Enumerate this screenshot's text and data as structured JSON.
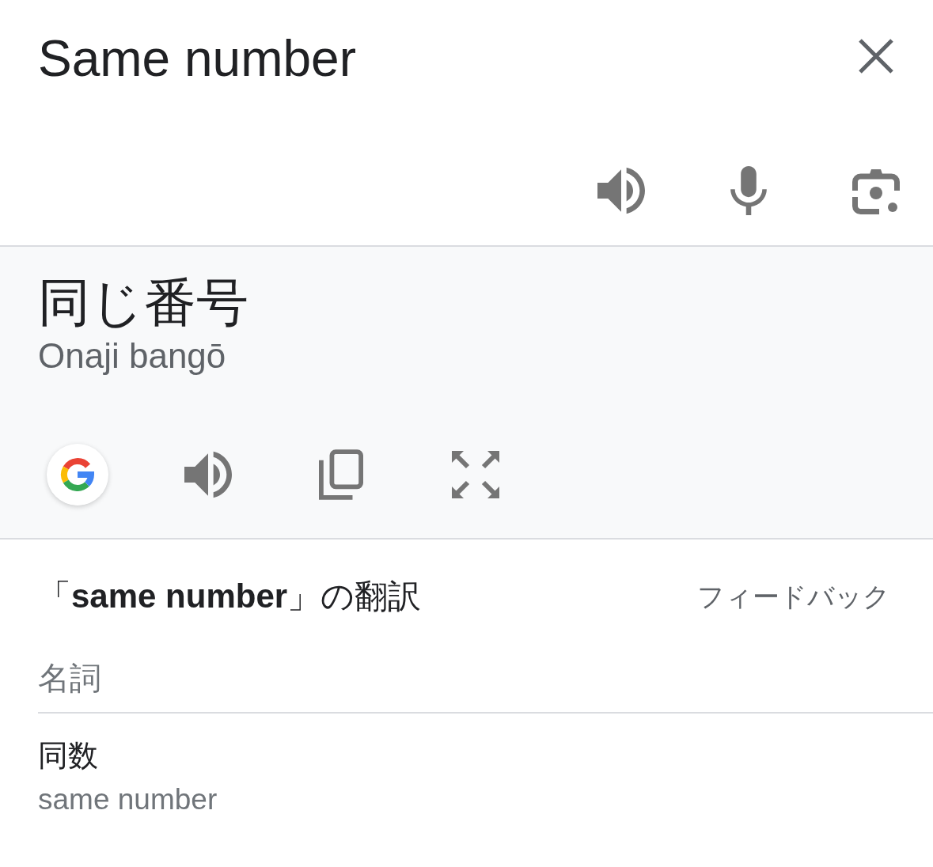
{
  "header": {
    "title": "Same number"
  },
  "translation": {
    "text": "同じ番号",
    "romanization": "Onaji bangō"
  },
  "dictionary": {
    "heading": "「**same number**」の翻訳",
    "feedback": "フィードバック",
    "groups": [
      {
        "part_of_speech": "名詞",
        "entries": [
          {
            "term": "同数",
            "gloss": "same number"
          }
        ]
      }
    ]
  }
}
